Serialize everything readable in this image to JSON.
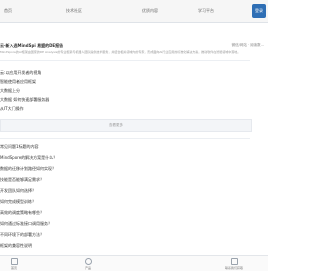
{
  "topnav": {
    "items": [
      "首页",
      "技术社区",
      "优质内容",
      "学习平台"
    ],
    "avatar": "登录"
  },
  "article": {
    "title": "云·新入选MindSpi 易盟的DE报告",
    "meta": "微信/网站 · 阅读数...",
    "summary": "MindSpore的AI框架由国家的DE Analysis的专业框架与机器人团队提供技术服务，并结合相关领域内的专家，形成面向AI行业应用的标准化解决方案，推动软件在智能领域中落地。"
  },
  "related": {
    "items": [
      "云:以应用开发者的视角",
      "智能使用者应用框架",
      "大数据上分",
      "大数据 如何快速部署服务器",
      "从IT大门操作"
    ],
    "more": "查看更多"
  },
  "qa": {
    "items": [
      "常见问题1标题的内容",
      "MindSpore的解决方案是什么？",
      "数据的迁移计划路径如何实现？",
      "技能是否能够满足需求？",
      "开发团队如何选择？",
      "如何完成模型训练？",
      "高效的调度策略有哪些？",
      "如何通过标准接口调用服务？",
      "不同环境下的部署方法？",
      "框架的兼容性说明"
    ]
  },
  "bottom": {
    "items": [
      "首页",
      "产品",
      "联系我们获取"
    ]
  }
}
